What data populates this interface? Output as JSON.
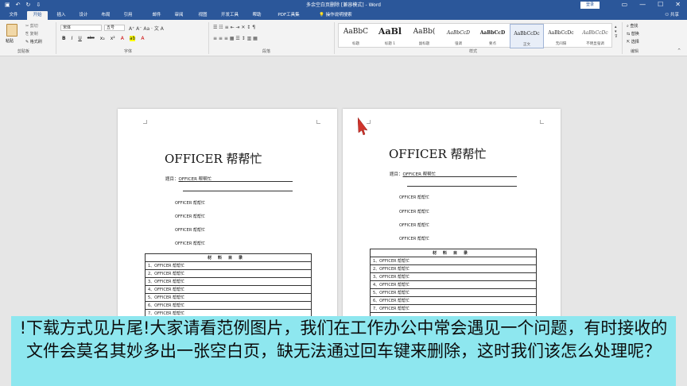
{
  "window": {
    "title": "多余空白页删除 [兼容模式] - Word",
    "quick_access": [
      "▣",
      "↶",
      "↻",
      "⇩"
    ],
    "login_label": "登录",
    "controls": [
      "▭",
      "—",
      "☐",
      "✕"
    ]
  },
  "tabs": [
    {
      "label": "文件"
    },
    {
      "label": "开始",
      "active": true
    },
    {
      "label": "插入"
    },
    {
      "label": "设计"
    },
    {
      "label": "布局"
    },
    {
      "label": "引用"
    },
    {
      "label": "邮件"
    },
    {
      "label": "审阅"
    },
    {
      "label": "视图"
    },
    {
      "label": "开发工具"
    },
    {
      "label": "帮助"
    },
    {
      "label": "PDF工具集"
    }
  ],
  "tell_me": "操作说明搜索",
  "share_label": "共享",
  "ribbon": {
    "paste_label": "粘贴",
    "clipboard_items": [
      "剪切",
      "复制",
      "格式刷"
    ],
    "font_name": "宋体",
    "font_size": "五号",
    "format_buttons": [
      "B",
      "I",
      "U",
      "abc",
      "x₂",
      "x²"
    ],
    "styles": [
      {
        "sample": "AaBbC",
        "name": "标题",
        "size": 9
      },
      {
        "sample": "AaBl",
        "name": "标题 1",
        "size": 11
      },
      {
        "sample": "AaBb(",
        "name": "副标题",
        "size": 9
      },
      {
        "sample": "AaBbCcD",
        "name": "强调",
        "size": 6
      },
      {
        "sample": "AaBbCcD",
        "name": "要点",
        "size": 6
      },
      {
        "sample": "AaBbCcDc",
        "name": "正文",
        "size": 6,
        "selected": true
      },
      {
        "sample": "AaBbCcDc",
        "name": "无间隔",
        "size": 6
      },
      {
        "sample": "AaBbCcDc",
        "name": "不明显强调",
        "size": 6
      }
    ],
    "editing": [
      "查找",
      "替换",
      "选择"
    ],
    "group_labels": [
      "剪贴板",
      "字体",
      "段落",
      "样式",
      "编辑"
    ]
  },
  "document": {
    "heading": "OFFICER 帮帮忙",
    "topic_label": "题目：",
    "topic_value": "OFFICER 帮帮忙",
    "plain_lines": [
      "OFFICER 帮帮忙",
      "OFFICER 帮帮忙",
      "OFFICER 帮帮忙",
      "OFFICER 帮帮忙"
    ],
    "table_header": "材料目录",
    "table_rows": [
      "1、OFFICER 帮帮忙",
      "2、OFFICER 帮帮忙",
      "3、OFFICER 帮帮忙",
      "4、OFFICER 帮帮忙",
      "5、OFFICER 帮帮忙",
      "6、OFFICER 帮帮忙",
      "7、OFFICER 帮帮忙"
    ]
  },
  "caption": "!下载方式见片尾!大家请看范例图片，我们在工作办公中常会遇见一个问题，有时接收的文件会莫名其妙多出一张空白页，缺无法通过回车键来删除，这时我们该怎么处理呢？",
  "colors": {
    "titlebar": "#2b579a",
    "ribbon": "#f3f3f3",
    "workspace": "#e6e6e6",
    "caption_bg": "#8ee7ef"
  }
}
